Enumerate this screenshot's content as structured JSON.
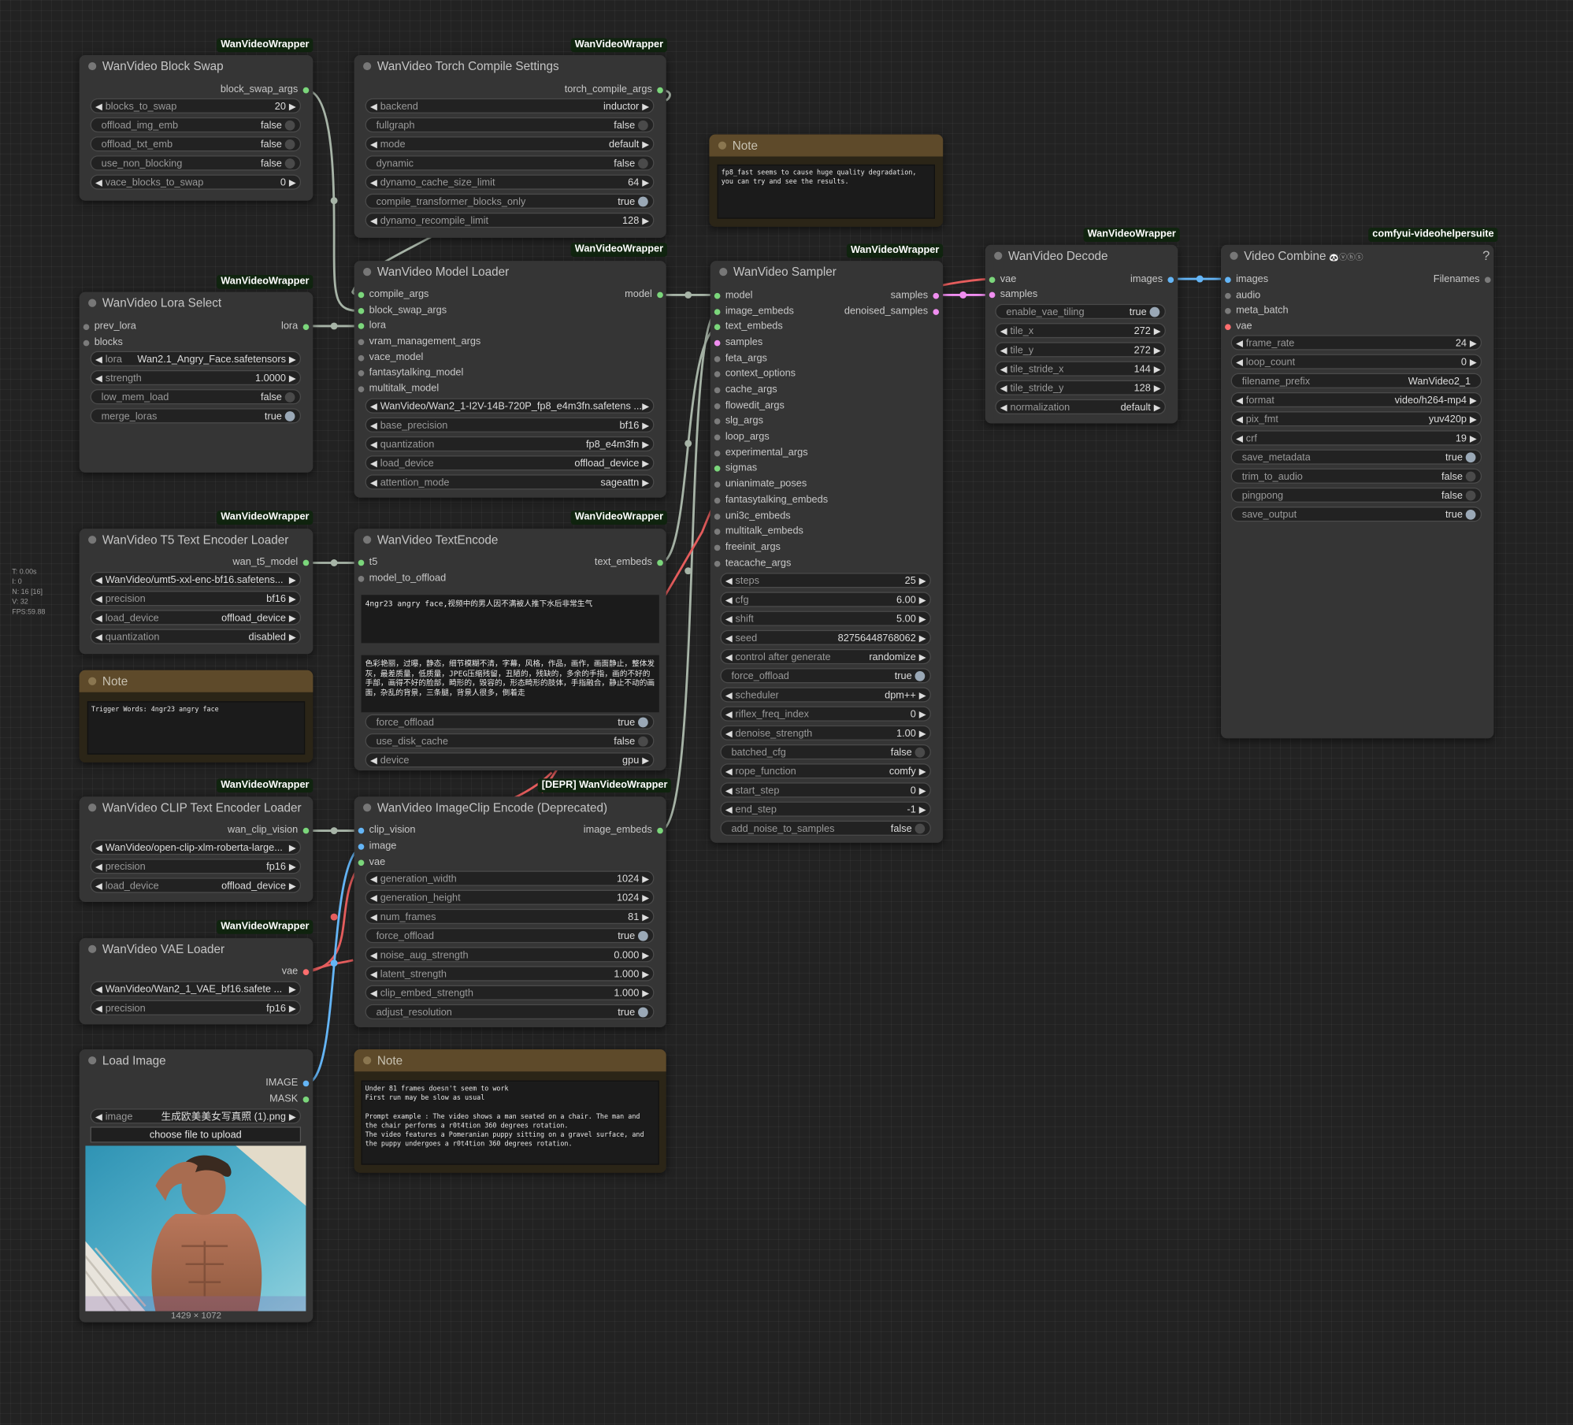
{
  "stats": {
    "t": "T: 0.00s",
    "i": "I: 0",
    "n": "N: 16 [16]",
    "v": "V: 32",
    "fps": "FPS:59.88"
  },
  "block_swap": {
    "badge": "WanVideoWrapper",
    "title": "WanVideo Block Swap",
    "out": "block_swap_args",
    "w": [
      {
        "l": "blocks_to_swap",
        "v": "20"
      },
      {
        "l": "offload_img_emb",
        "v": "false"
      },
      {
        "l": "offload_txt_emb",
        "v": "false"
      },
      {
        "l": "use_non_blocking",
        "v": "false"
      },
      {
        "l": "vace_blocks_to_swap",
        "v": "0"
      }
    ]
  },
  "torch": {
    "badge": "WanVideoWrapper",
    "title": "WanVideo Torch Compile Settings",
    "out": "torch_compile_args",
    "w": [
      {
        "l": "backend",
        "v": "inductor"
      },
      {
        "l": "fullgraph",
        "v": "false"
      },
      {
        "l": "mode",
        "v": "default"
      },
      {
        "l": "dynamic",
        "v": "false"
      },
      {
        "l": "dynamo_cache_size_limit",
        "v": "64"
      },
      {
        "l": "compile_transformer_blocks_only",
        "v": "true"
      },
      {
        "l": "dynamo_recompile_limit",
        "v": "128"
      }
    ]
  },
  "note1": {
    "title": "Note",
    "text": "fp8_fast seems to cause huge quality degradation, you can try and see the results."
  },
  "lora": {
    "badge": "WanVideoWrapper",
    "title": "WanVideo Lora Select",
    "in": [
      "prev_lora",
      "blocks"
    ],
    "out": "lora",
    "w": [
      {
        "l": "lora",
        "v": "Wan2.1_Angry_Face.safetensors"
      },
      {
        "l": "strength",
        "v": "1.0000"
      },
      {
        "l": "low_mem_load",
        "v": "false"
      },
      {
        "l": "merge_loras",
        "v": "true"
      }
    ]
  },
  "model_loader": {
    "badge": "WanVideoWrapper",
    "title": "WanVideo Model Loader",
    "out": "model",
    "in": [
      "compile_args",
      "block_swap_args",
      "lora",
      "vram_management_args",
      "vace_model",
      "fantasytalking_model",
      "multitalk_model"
    ],
    "w": [
      {
        "l": "",
        "v": "WanVideo/Wan2_1-I2V-14B-720P_fp8_e4m3fn.safetens ..."
      },
      {
        "l": "base_precision",
        "v": "bf16"
      },
      {
        "l": "quantization",
        "v": "fp8_e4m3fn"
      },
      {
        "l": "load_device",
        "v": "offload_device"
      },
      {
        "l": "attention_mode",
        "v": "sageattn"
      }
    ]
  },
  "sampler": {
    "badge": "WanVideoWrapper",
    "title": "WanVideo Sampler",
    "out": [
      "samples",
      "denoised_samples"
    ],
    "in": [
      "model",
      "image_embeds",
      "text_embeds",
      "samples",
      "feta_args",
      "context_options",
      "cache_args",
      "flowedit_args",
      "slg_args",
      "loop_args",
      "experimental_args",
      "sigmas",
      "unianimate_poses",
      "fantasytalking_embeds",
      "uni3c_embeds",
      "multitalk_embeds",
      "freeinit_args",
      "teacache_args"
    ],
    "w": [
      {
        "l": "steps",
        "v": "25"
      },
      {
        "l": "cfg",
        "v": "6.00"
      },
      {
        "l": "shift",
        "v": "5.00"
      },
      {
        "l": "seed",
        "v": "82756448768062"
      },
      {
        "l": "control after generate",
        "v": "randomize"
      },
      {
        "l": "force_offload",
        "v": "true"
      },
      {
        "l": "scheduler",
        "v": "dpm++"
      },
      {
        "l": "riflex_freq_index",
        "v": "0"
      },
      {
        "l": "denoise_strength",
        "v": "1.00"
      },
      {
        "l": "batched_cfg",
        "v": "false"
      },
      {
        "l": "rope_function",
        "v": "comfy"
      },
      {
        "l": "start_step",
        "v": "0"
      },
      {
        "l": "end_step",
        "v": "-1"
      },
      {
        "l": "add_noise_to_samples",
        "v": "false"
      }
    ]
  },
  "decode": {
    "badge": "WanVideoWrapper",
    "title": "WanVideo Decode",
    "in": [
      "vae",
      "samples"
    ],
    "out": "images",
    "w": [
      {
        "l": "enable_vae_tiling",
        "v": "true"
      },
      {
        "l": "tile_x",
        "v": "272"
      },
      {
        "l": "tile_y",
        "v": "272"
      },
      {
        "l": "tile_stride_x",
        "v": "144"
      },
      {
        "l": "tile_stride_y",
        "v": "128"
      },
      {
        "l": "normalization",
        "v": "default"
      }
    ]
  },
  "combine": {
    "badge": "comfyui-videohelpersuite",
    "title": "Video Combine",
    "icons": "🐼ⓥⓗⓢ",
    "help": "?",
    "in": [
      "images",
      "audio",
      "meta_batch",
      "vae"
    ],
    "out": "Filenames",
    "w": [
      {
        "l": "frame_rate",
        "v": "24"
      },
      {
        "l": "loop_count",
        "v": "0"
      },
      {
        "l": "filename_prefix",
        "v": "WanVideo2_1"
      },
      {
        "l": "format",
        "v": "video/h264-mp4"
      },
      {
        "l": "pix_fmt",
        "v": "yuv420p"
      },
      {
        "l": "crf",
        "v": "19"
      },
      {
        "l": "save_metadata",
        "v": "true"
      },
      {
        "l": "trim_to_audio",
        "v": "false"
      },
      {
        "l": "pingpong",
        "v": "false"
      },
      {
        "l": "save_output",
        "v": "true"
      }
    ]
  },
  "t5": {
    "badge": "WanVideoWrapper",
    "title": "WanVideo T5 Text Encoder Loader",
    "out": "wan_t5_model",
    "w": [
      {
        "l": "",
        "v": "WanVideo/umt5-xxl-enc-bf16.safetens..."
      },
      {
        "l": "precision",
        "v": "bf16"
      },
      {
        "l": "load_device",
        "v": "offload_device"
      },
      {
        "l": "quantization",
        "v": "disabled"
      }
    ]
  },
  "textencode": {
    "badge": "WanVideoWrapper",
    "title": "WanVideo TextEncode",
    "in": [
      "t5",
      "model_to_offload"
    ],
    "out": "text_embeds",
    "positive": "4ngr23 angry face,视频中的男人因不满被人推下水后非常生气",
    "negative": "色彩艳丽，过曝，静态，细节模糊不清，字幕，风格，作品，画作，画面静止，整体发灰，最差质量，低质量，JPEG压缩残留，丑陋的，残缺的，多余的手指，画的不好的手部，画得不好的脸部，畸形的，毁容的，形态畸形的肢体，手指融合，静止不动的画面，杂乱的背景，三条腿，背景人很多，倒着走",
    "w": [
      {
        "l": "force_offload",
        "v": "true"
      },
      {
        "l": "use_disk_cache",
        "v": "false"
      },
      {
        "l": "device",
        "v": "gpu"
      }
    ]
  },
  "note2": {
    "title": "Note",
    "text": "Trigger Words: 4ngr23 angry face"
  },
  "clip": {
    "badge": "WanVideoWrapper",
    "title": "WanVideo CLIP Text Encoder Loader",
    "out": "wan_clip_vision",
    "w": [
      {
        "l": "",
        "v": "WanVideo/open-clip-xlm-roberta-large..."
      },
      {
        "l": "precision",
        "v": "fp16"
      },
      {
        "l": "load_device",
        "v": "offload_device"
      }
    ]
  },
  "imageclip": {
    "badge": "[DEPR] WanVideoWrapper",
    "title": "WanVideo ImageClip Encode (Deprecated)",
    "in": [
      "clip_vision",
      "image",
      "vae"
    ],
    "out": "image_embeds",
    "w": [
      {
        "l": "generation_width",
        "v": "1024"
      },
      {
        "l": "generation_height",
        "v": "1024"
      },
      {
        "l": "num_frames",
        "v": "81"
      },
      {
        "l": "force_offload",
        "v": "true"
      },
      {
        "l": "noise_aug_strength",
        "v": "0.000"
      },
      {
        "l": "latent_strength",
        "v": "1.000"
      },
      {
        "l": "clip_embed_strength",
        "v": "1.000"
      },
      {
        "l": "adjust_resolution",
        "v": "true"
      }
    ]
  },
  "vae": {
    "badge": "WanVideoWrapper",
    "title": "WanVideo VAE Loader",
    "out": "vae",
    "w": [
      {
        "l": "",
        "v": "WanVideo/Wan2_1_VAE_bf16.safete ..."
      },
      {
        "l": "precision",
        "v": "fp16"
      }
    ]
  },
  "loadimage": {
    "title": "Load Image",
    "out": [
      "IMAGE",
      "MASK"
    ],
    "w": [
      {
        "l": "image",
        "v": "生成欧美美女写真照 (1).png"
      }
    ],
    "upload": "choose file to upload",
    "caption": "1429 × 1072"
  },
  "note3": {
    "title": "Note",
    "text": "Under 81 frames doesn't seem to work\nFirst run may be slow as usual\n\nPrompt example : The video shows a man seated on a chair. The man and the chair performs a r0t4tion 360 degrees rotation.\nThe video features a Pomeranian puppy sitting on a gravel surface, and the puppy undergoes a r0t4tion 360 degrees rotation."
  },
  "colors": {
    "canvas": "#222222",
    "node": "#353535",
    "badge": "#10240f",
    "note": "#5e4a2a",
    "link_green": "#9aa89a",
    "link_pink": "#f08ef0",
    "link_red": "#e55d5d",
    "link_blue": "#64b5f6"
  }
}
